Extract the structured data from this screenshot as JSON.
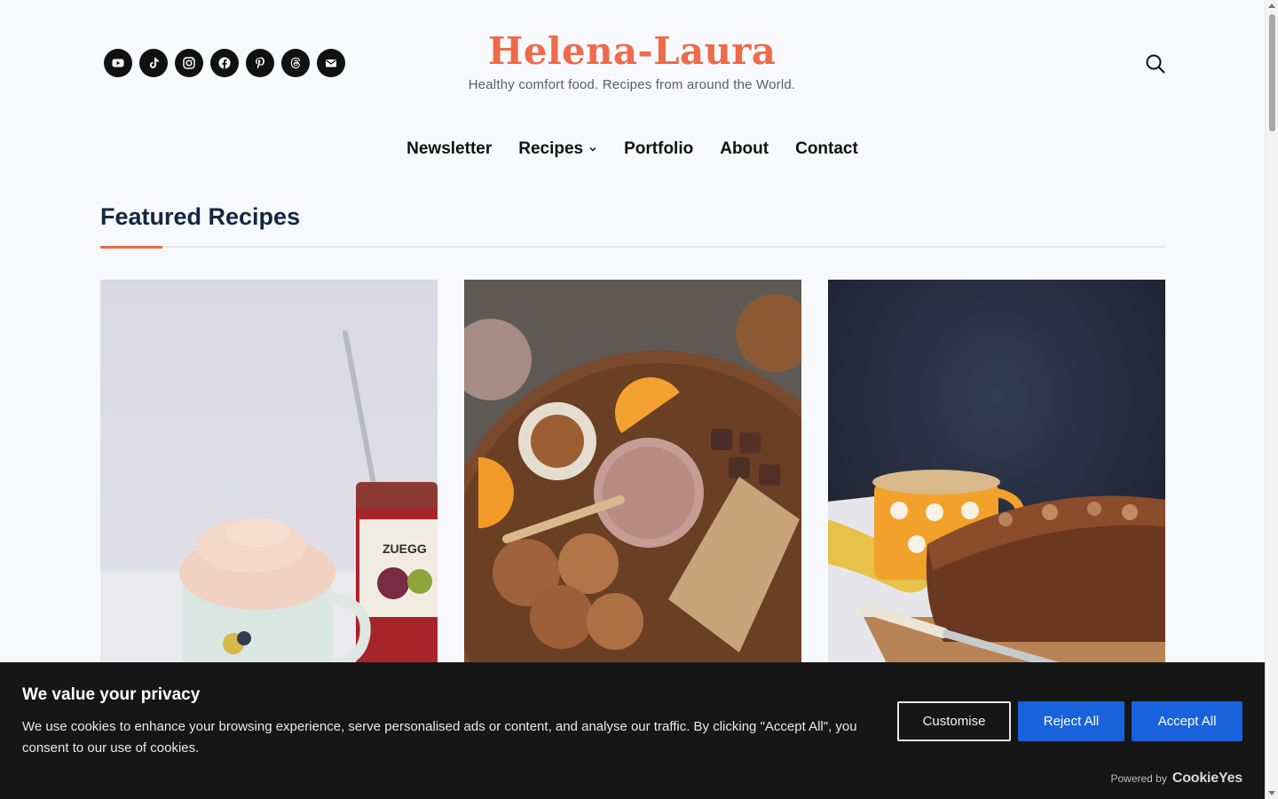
{
  "header": {
    "site_title": "Helena-Laura",
    "tagline": "Healthy comfort food. Recipes from around the World.",
    "social_links": [
      {
        "icon": "youtube-icon"
      },
      {
        "icon": "tiktok-icon"
      },
      {
        "icon": "instagram-icon"
      },
      {
        "icon": "facebook-icon"
      },
      {
        "icon": "pinterest-icon"
      },
      {
        "icon": "threads-icon"
      },
      {
        "icon": "mail-icon"
      }
    ],
    "search_icon": "search-icon"
  },
  "nav": {
    "items": [
      {
        "label": "Newsletter"
      },
      {
        "label": "Recipes",
        "has_dropdown": true
      },
      {
        "label": "Portfolio"
      },
      {
        "label": "About"
      },
      {
        "label": "Contact"
      }
    ]
  },
  "main": {
    "section_title": "Featured Recipes",
    "cards": [
      {
        "image": "mug-with-whipped-cream-and-jam-jar"
      },
      {
        "image": "chocolate-smoothie-with-cookies-and-oranges"
      },
      {
        "image": "banana-bread-loaf-with-mug"
      }
    ]
  },
  "cookie_banner": {
    "title": "We value your privacy",
    "text": "We use cookies to enhance your browsing experience, serve personalised ads or content, and analyse our traffic. By clicking \"Accept All\", you consent to our use of cookies.",
    "customise_label": "Customise",
    "reject_label": "Reject All",
    "accept_label": "Accept All",
    "powered_by_label": "Powered by",
    "powered_by_brand": "CookieYes"
  },
  "colors": {
    "background": "#f7f9fc",
    "brand": "#ee6a48",
    "heading": "#13273f",
    "banner": "#161616",
    "button_blue": "#1863dc"
  }
}
